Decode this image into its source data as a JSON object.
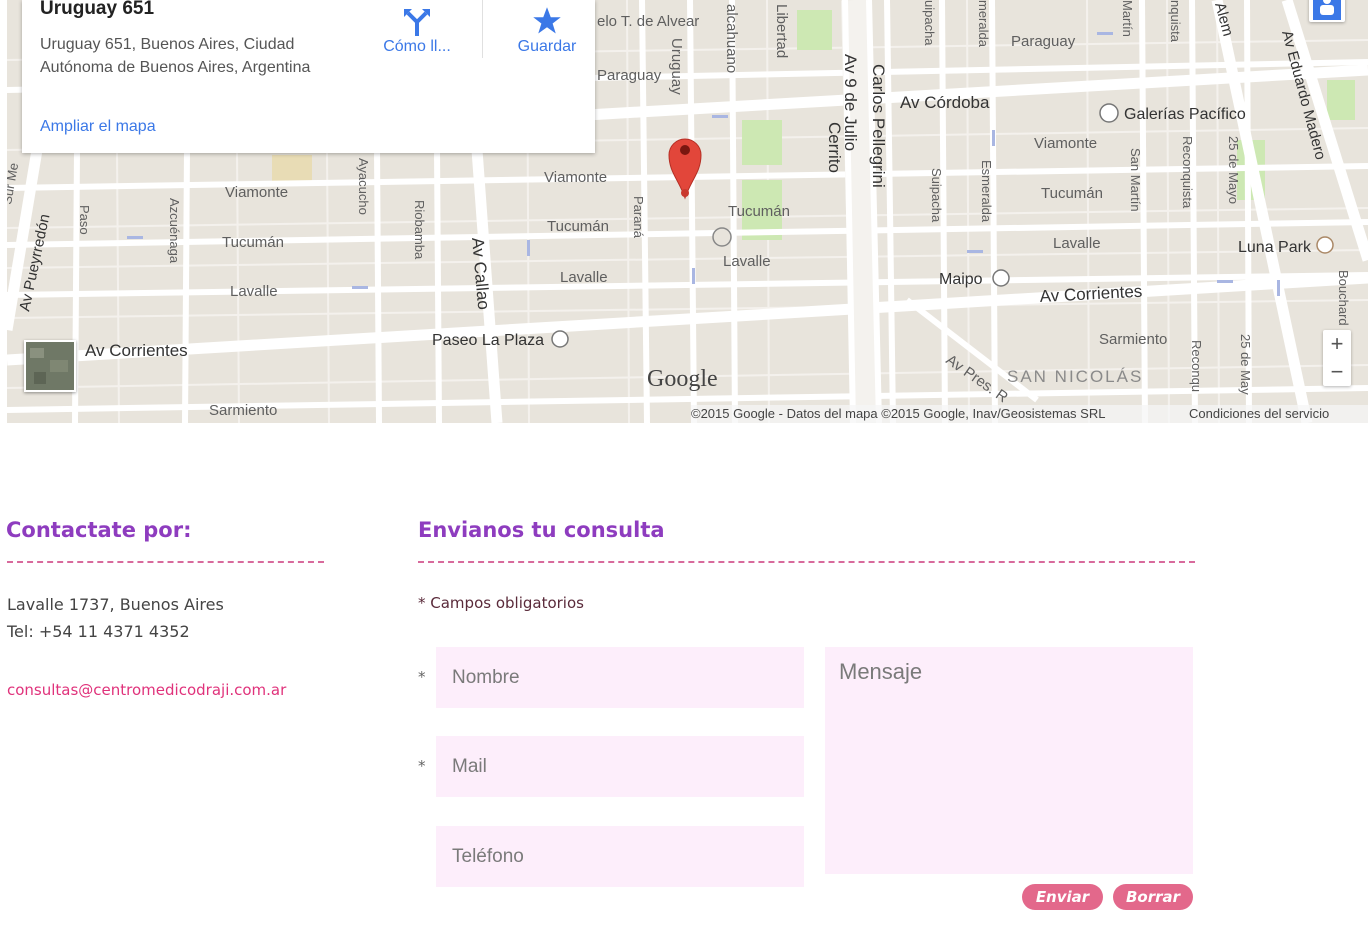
{
  "map": {
    "card": {
      "title": "Uruguay 651",
      "address": "Uruguay 651, Buenos Aires, Ciudad Autónoma de Buenos Aires, Argentina",
      "enlarge_link": "Ampliar el mapa",
      "directions_label": "Cómo ll...",
      "save_label": "Guardar"
    },
    "streets": {
      "alvear": "elo T. de Alvear",
      "talcahuano": "alcahuano",
      "libertad": "Libertad",
      "av_9_julio": "Av 9 de Julio",
      "cerrito": "Cerrito",
      "carlos_pellegrini": "Carlos Pellegrini",
      "suipacha_top": "uipacha",
      "esmeralda_top": "meralda",
      "paraguay_right": "Paraguay",
      "martin_top": "Martín",
      "reconquista_top": "nquista",
      "alem": "Alem",
      "eduardo_madero": "Av Eduardo Madero",
      "paraguay_left": "Paraguay",
      "uruguay": "Uruguay",
      "av_cordoba": "Av Córdoba",
      "viamonte_left": "Viamonte",
      "viamonte_center": "Viamonte",
      "viamonte_right": "Viamonte",
      "tucuman_left": "Tucumán",
      "tucuman_center": "Tucumán",
      "tucuman_center2": "Tucumán",
      "tucuman_right": "Tucumán",
      "lavalle_left": "Lavalle",
      "lavalle_center": "Lavalle",
      "lavalle_center2": "Lavalle",
      "lavalle_right": "Lavalle",
      "av_pueyrredon": "Av Pueyrredón",
      "paso": "Paso",
      "azcuenaga": "Azcuénaga",
      "ayacucho": "Ayacucho",
      "riobamba": "Riobamba",
      "av_callao": "Av Callao",
      "parana": "Paraná",
      "suipacha": "Suipacha",
      "esmeralda": "Esmeralda",
      "san_martin": "San Martín",
      "reconquista": "Reconquista",
      "mayo_25": "25 de Mayo",
      "av_corrientes_left": "Av Corrientes",
      "av_corrientes_right": "Av Corrientes",
      "sarmiento_left": "Sarmiento",
      "sarmiento_right": "Sarmiento",
      "pres": "Av Pres. R",
      "bouchard": "Bouchard",
      "recon_bottom": "Reconqu",
      "mayo_bottom": "25 de May",
      "sur_mendoza": "Sur Me"
    },
    "places": {
      "galerias": "Galerías Pacífico",
      "luna_park": "Luna Park",
      "maipo": "Maipo",
      "paseo_plaza": "Paseo La Plaza",
      "san_nicolas": "SAN NICOLÁS"
    },
    "google_logo": "Google",
    "copyright": "©2015 Google - Datos del mapa ©2015 Google, Inav/Geosistemas SRL",
    "terms": "Condiciones del servicio",
    "zoom_in": "+",
    "zoom_out": "−"
  },
  "contact": {
    "heading": "Contactate por:",
    "address": "Lavalle 1737, Buenos Aires",
    "phone": "Tel: +54 11 4371 4352",
    "email": "consultas@centromedicodraji.com.ar"
  },
  "form": {
    "heading": "Envianos tu consulta",
    "required_note": "* Campos obligatorios",
    "required_mark": "*",
    "name_placeholder": "Nombre",
    "mail_placeholder": "Mail",
    "phone_placeholder": "Teléfono",
    "message_placeholder": "Mensaje",
    "submit_label": "Enviar",
    "reset_label": "Borrar"
  },
  "colors": {
    "heading": "#8e3cbf",
    "dashed_rule": "#d86a9c",
    "email_link": "#e0327b",
    "field_bg": "#fdeefb",
    "button_bg": "#e3688b",
    "map_link": "#3b78e7",
    "marker": "#e2463a"
  }
}
